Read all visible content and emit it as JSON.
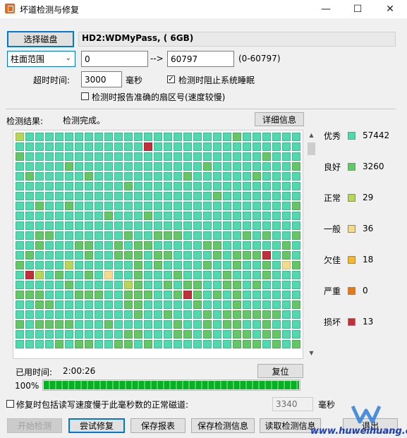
{
  "window": {
    "title": "坏道检测与修复"
  },
  "top": {
    "select_disk_label": "选择磁盘",
    "disk_info": "HD2:WDMyPass,       (   6GB)",
    "range_mode": "柱面范围",
    "range_start": "0",
    "arrow": "-->",
    "range_end": "60797",
    "range_hint": "(0-60797)",
    "timeout_label": "超时时间:",
    "timeout_value": "3000",
    "timeout_unit": "毫秒",
    "prevent_sleep_label": "检测时阻止系统睡眠",
    "prevent_sleep_checked": true,
    "report_sector_label": "检测时报告准确的扇区号(速度较慢)",
    "report_sector_checked": false
  },
  "result": {
    "label": "检测结果:",
    "status": "检测完成。",
    "detail_button": "详细信息"
  },
  "legend": [
    {
      "label": "优秀",
      "count": "57442",
      "color": "#4fd9ad"
    },
    {
      "label": "良好",
      "count": "3260",
      "color": "#64c767"
    },
    {
      "label": "正常",
      "count": "29",
      "color": "#b6d65a"
    },
    {
      "label": "一般",
      "count": "36",
      "color": "#f2dc8c"
    },
    {
      "label": "欠佳",
      "count": "18",
      "color": "#f2b830"
    },
    {
      "label": "严重",
      "count": "0",
      "color": "#e07a1a"
    },
    {
      "label": "损坏",
      "count": "13",
      "color": "#c0303a"
    }
  ],
  "timing": {
    "elapsed_label": "已用时间:",
    "elapsed_value": "2:00:26",
    "reset_button": "复位",
    "percent_text": "100%",
    "progress": 1.0
  },
  "repair": {
    "option_label": "修复时包括读写速度慢于此毫秒数的正常磁道:",
    "option_checked": false,
    "threshold_value": "3340",
    "threshold_unit": "毫秒"
  },
  "buttons": {
    "start": "开始检测",
    "try_repair": "尝试修复",
    "save_report": "保存报表",
    "save_info": "保存检测信息",
    "read_info": "读取检测信息",
    "exit": "退出"
  },
  "watermark": {
    "text": "www.huweihuang.com"
  }
}
